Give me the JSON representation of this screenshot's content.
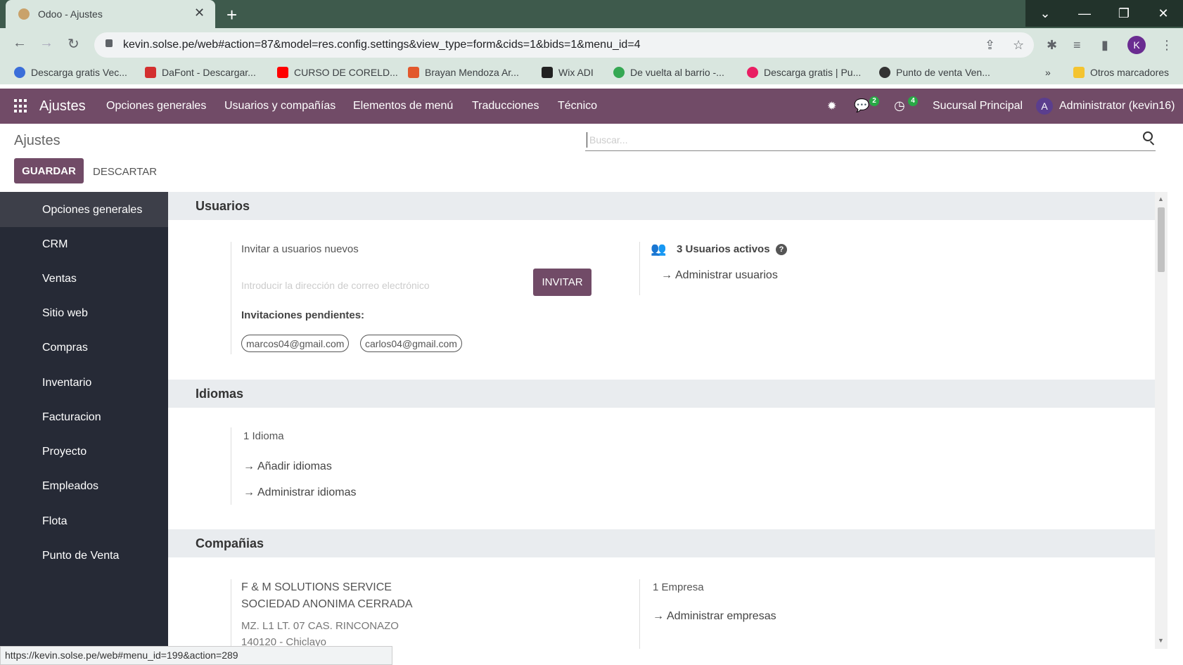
{
  "browser": {
    "tab_title": "Odoo - Ajustes",
    "url": "kevin.solse.pe/web#action=87&model=res.config.settings&view_type=form&cids=1&bids=1&menu_id=4",
    "profile_initial": "K",
    "bookmarks": [
      "Descarga gratis Vec...",
      "DaFont - Descargar...",
      "CURSO DE CORELD...",
      "Brayan Mendoza Ar...",
      "Wix ADI",
      "De vuelta al barrio -...",
      "Descarga gratis | Pu...",
      "Punto de venta Ven..."
    ],
    "bookmarks_overflow": "»",
    "other_bookmarks": "Otros marcadores",
    "status_url": "https://kevin.solse.pe/web#menu_id=199&action=289"
  },
  "odoo_nav": {
    "app_name": "Ajustes",
    "menu": [
      "Opciones generales",
      "Usuarios y compañías",
      "Elementos de menú",
      "Traducciones",
      "Técnico"
    ],
    "messages_count": "2",
    "activities_count": "4",
    "branch": "Sucursal Principal",
    "user_initial": "A",
    "user_name": "Administrator (kevin16)"
  },
  "control_panel": {
    "breadcrumb": "Ajustes",
    "search_placeholder": "Buscar...",
    "save_label": "GUARDAR",
    "discard_label": "DESCARTAR"
  },
  "sidebar": {
    "items": [
      "Opciones generales",
      "CRM",
      "Ventas",
      "Sitio web",
      "Compras",
      "Inventario",
      "Facturacion",
      "Proyecto",
      "Empleados",
      "Flota",
      "Punto de Venta"
    ]
  },
  "users_section": {
    "title": "Usuarios",
    "invite_label": "Invitar a usuarios nuevos",
    "email_placeholder": "Introducir la dirección de correo electrónico",
    "invite_button": "INVITAR",
    "pending_label": "Invitaciones pendientes:",
    "pending": [
      "marcos04@gmail.com",
      "carlos04@gmail.com"
    ],
    "active_users": "3 Usuarios activos",
    "manage_users": "Administrar usuarios"
  },
  "languages_section": {
    "title": "Idiomas",
    "count": "1 Idioma",
    "add": "Añadir idiomas",
    "manage": "Administrar idiomas"
  },
  "companies_section": {
    "title": "Compañias",
    "company_name_1": "F & M SOLUTIONS SERVICE",
    "company_name_2": "SOCIEDAD ANONIMA CERRADA",
    "address_1": "MZ. L1 LT. 07 CAS. RINCONAZO",
    "address_2": "140120 - Chiclayo",
    "count": "1 Empresa",
    "manage": "Administrar empresas"
  }
}
